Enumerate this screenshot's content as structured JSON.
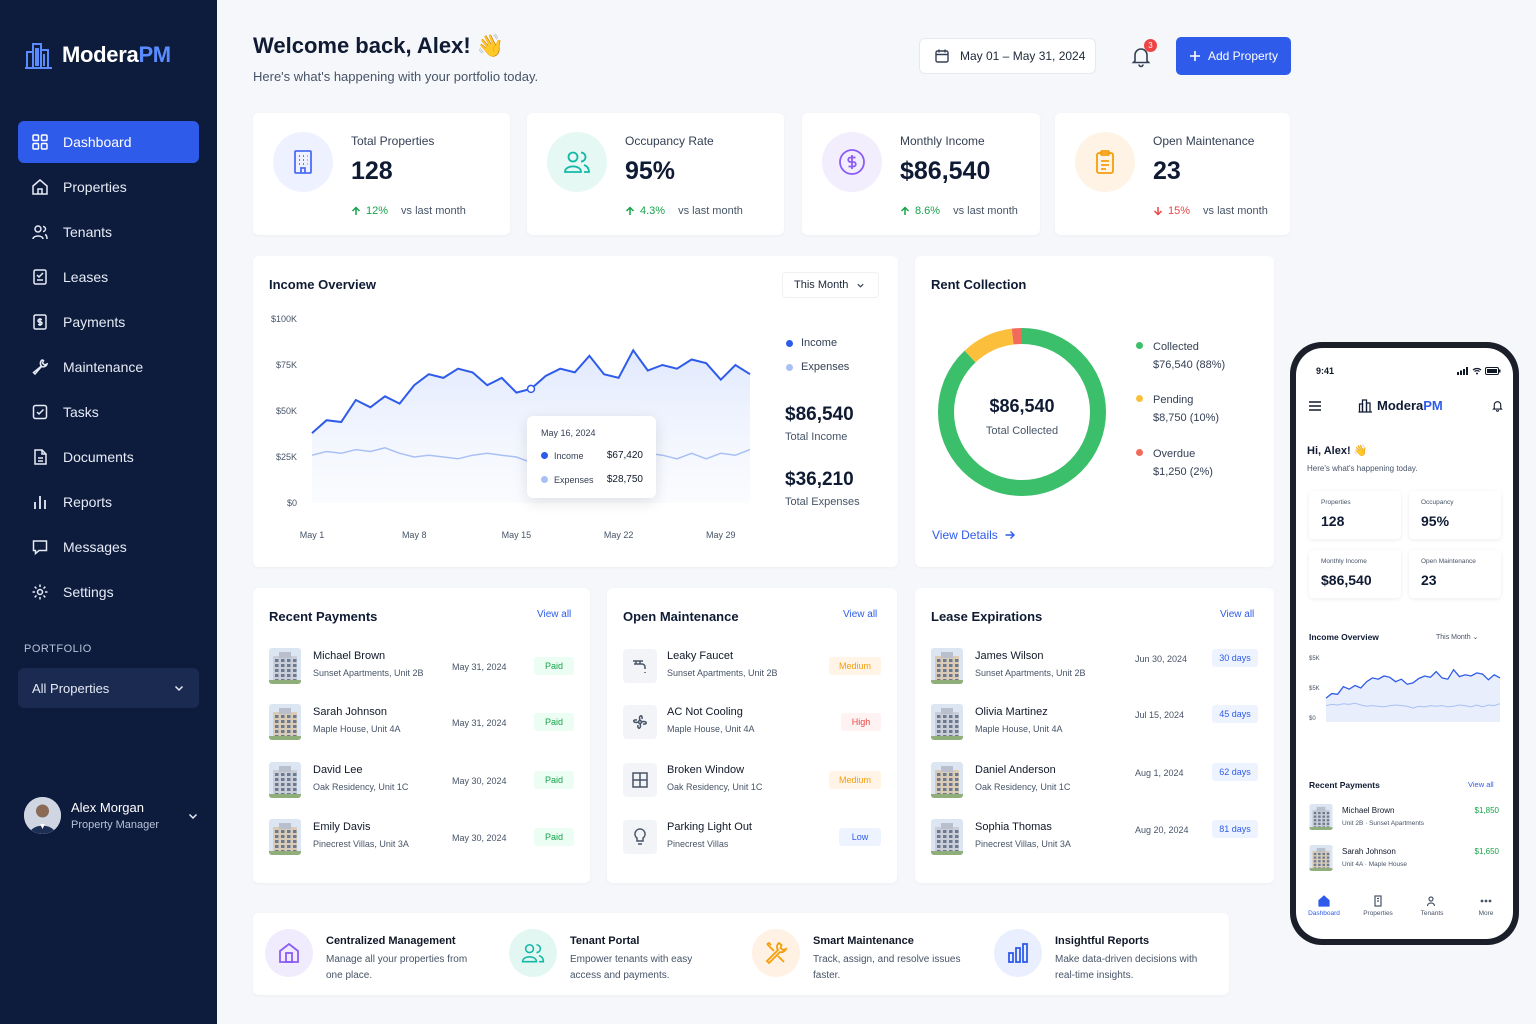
{
  "app": {
    "brand_main": "Modera",
    "brand_accent": "PM"
  },
  "sidebar": {
    "items": [
      {
        "label": "Dashboard",
        "icon": "dashboard-icon",
        "active": true
      },
      {
        "label": "Properties",
        "icon": "home-icon"
      },
      {
        "label": "Tenants",
        "icon": "users-icon"
      },
      {
        "label": "Leases",
        "icon": "lease-icon"
      },
      {
        "label": "Payments",
        "icon": "payment-icon"
      },
      {
        "label": "Maintenance",
        "icon": "wrench-icon"
      },
      {
        "label": "Tasks",
        "icon": "checkbox-icon"
      },
      {
        "label": "Documents",
        "icon": "document-icon"
      },
      {
        "label": "Reports",
        "icon": "bar-chart-icon"
      },
      {
        "label": "Messages",
        "icon": "message-icon"
      },
      {
        "label": "Settings",
        "icon": "gear-icon"
      }
    ],
    "portfolio_label": "PORTFOLIO",
    "portfolio_value": "All Properties",
    "user": {
      "name": "Alex Morgan",
      "role": "Property Manager"
    }
  },
  "header": {
    "welcome": "Welcome back, Alex! 👋",
    "subtitle": "Here's what's happening with your portfolio today.",
    "date_range": "May 01 – May 31, 2024",
    "notifications": "3",
    "add_button": "Add Property"
  },
  "stats": [
    {
      "label": "Total Properties",
      "value": "128",
      "change": "12%",
      "direction": "up",
      "vs": "vs last month",
      "color": "#4f6df5"
    },
    {
      "label": "Occupancy Rate",
      "value": "95%",
      "change": "4.3%",
      "direction": "up",
      "vs": "vs last month",
      "color": "#14b8a6"
    },
    {
      "label": "Monthly Income",
      "value": "$86,540",
      "change": "8.6%",
      "direction": "up",
      "vs": "vs last month",
      "color": "#8b5cf6"
    },
    {
      "label": "Open Maintenance",
      "value": "23",
      "change": "15%",
      "direction": "down",
      "vs": "vs last month",
      "color": "#f59e0b"
    }
  ],
  "income_overview": {
    "title": "Income Overview",
    "period": "This Month",
    "legend_income": "Income",
    "legend_expenses": "Expenses",
    "total_income": "$86,540",
    "total_income_label": "Total Income",
    "total_expenses": "$36,210",
    "total_expenses_label": "Total Expenses",
    "tooltip": {
      "date": "May 16, 2024",
      "income_label": "Income",
      "income_value": "$67,420",
      "expenses_label": "Expenses",
      "expenses_value": "$28,750"
    }
  },
  "chart_data": {
    "type": "area",
    "y_ticks": [
      "$100K",
      "$75K",
      "$50K",
      "$25K",
      "$0"
    ],
    "x_ticks": [
      "May 1",
      "May 8",
      "May 15",
      "May 22",
      "May 29"
    ],
    "ylim": [
      0,
      100000
    ],
    "x": [
      1,
      2,
      3,
      4,
      5,
      6,
      7,
      8,
      9,
      10,
      11,
      12,
      13,
      14,
      15,
      16,
      17,
      18,
      19,
      20,
      21,
      22,
      23,
      24,
      25,
      26,
      27,
      28,
      29,
      30,
      31
    ],
    "series": [
      {
        "name": "Income",
        "color": "#2f5bea",
        "values": [
          38000,
          45000,
          44000,
          56000,
          52000,
          58000,
          54000,
          64000,
          70000,
          68000,
          73000,
          71000,
          64000,
          68000,
          60000,
          62000,
          69000,
          73000,
          71000,
          80000,
          70000,
          68000,
          83000,
          72000,
          75000,
          73000,
          78000,
          76000,
          67000,
          75000,
          70000
        ]
      },
      {
        "name": "Expenses",
        "color": "#a9c0f5",
        "values": [
          26000,
          28000,
          27000,
          29000,
          28000,
          30000,
          27000,
          25000,
          26000,
          25000,
          24000,
          26000,
          27000,
          26000,
          25000,
          22000,
          25000,
          24000,
          26000,
          25000,
          26000,
          24000,
          25000,
          27000,
          26000,
          24000,
          27000,
          24000,
          27000,
          26000,
          29000
        ]
      }
    ]
  },
  "rent_collection": {
    "title": "Rent Collection",
    "total": "$86,540",
    "total_label": "Total Collected",
    "segments": [
      {
        "label": "Collected",
        "value": "$76,540 (88%)",
        "share": 88,
        "color": "#3cbf6b"
      },
      {
        "label": "Pending",
        "value": "$8,750 (10%)",
        "share": 10,
        "color": "#fbbf3c"
      },
      {
        "label": "Overdue",
        "value": "$1,250 (2%)",
        "share": 2,
        "color": "#f26a5b"
      }
    ],
    "view_details": "View Details"
  },
  "recent_payments": {
    "title": "Recent Payments",
    "view_all": "View all",
    "rows": [
      {
        "name": "Michael Brown",
        "sub": "Sunset Apartments, Unit 2B",
        "date": "May 31, 2024",
        "status": "Paid"
      },
      {
        "name": "Sarah Johnson",
        "sub": "Maple House, Unit 4A",
        "date": "May 31, 2024",
        "status": "Paid"
      },
      {
        "name": "David Lee",
        "sub": "Oak Residency, Unit 1C",
        "date": "May 30, 2024",
        "status": "Paid"
      },
      {
        "name": "Emily Davis",
        "sub": "Pinecrest Villas, Unit 3A",
        "date": "May 30, 2024",
        "status": "Paid"
      }
    ]
  },
  "open_maintenance": {
    "title": "Open Maintenance",
    "view_all": "View all",
    "rows": [
      {
        "name": "Leaky Faucet",
        "sub": "Sunset Apartments, Unit 2B",
        "priority": "Medium",
        "icon": "faucet-icon"
      },
      {
        "name": "AC Not Cooling",
        "sub": "Maple House, Unit 4A",
        "priority": "High",
        "icon": "fan-icon"
      },
      {
        "name": "Broken Window",
        "sub": "Oak Residency, Unit 1C",
        "priority": "Medium",
        "icon": "window-icon"
      },
      {
        "name": "Parking Light Out",
        "sub": "Pinecrest Villas",
        "priority": "Low",
        "icon": "lightbulb-icon"
      }
    ]
  },
  "lease_expirations": {
    "title": "Lease Expirations",
    "view_all": "View all",
    "rows": [
      {
        "name": "James Wilson",
        "sub": "Sunset Apartments, Unit 2B",
        "date": "Jun 30, 2024",
        "days": "30 days"
      },
      {
        "name": "Olivia Martinez",
        "sub": "Maple House, Unit 4A",
        "date": "Jul 15, 2024",
        "days": "45 days"
      },
      {
        "name": "Daniel Anderson",
        "sub": "Oak Residency, Unit 1C",
        "date": "Aug 1, 2024",
        "days": "62 days"
      },
      {
        "name": "Sophia Thomas",
        "sub": "Pinecrest Villas, Unit 3A",
        "date": "Aug 20, 2024",
        "days": "81 days"
      }
    ]
  },
  "features": [
    {
      "title": "Centralized Management",
      "desc": "Manage all your properties from one place.",
      "color": "#8b5cf6"
    },
    {
      "title": "Tenant Portal",
      "desc": "Empower tenants with easy access and payments.",
      "color": "#14b8a6"
    },
    {
      "title": "Smart Maintenance",
      "desc": "Track, assign, and resolve issues faster.",
      "color": "#f59e0b"
    },
    {
      "title": "Insightful Reports",
      "desc": "Make data-driven decisions with real-time insights.",
      "color": "#2f5bea"
    }
  ],
  "phone": {
    "time": "9:41",
    "greeting": "Hi, Alex! 👋",
    "sub": "Here's what's happening today.",
    "cards": [
      {
        "label": "Properties",
        "value": "128"
      },
      {
        "label": "Occupancy",
        "value": "95%"
      },
      {
        "label": "Monthly Income",
        "value": "$86,540"
      },
      {
        "label": "Open Maintenance",
        "value": "23"
      }
    ],
    "income_title": "Income Overview",
    "period": "This Month",
    "y_ticks": [
      "$5K",
      "$5K",
      "$0"
    ],
    "payments_title": "Recent Payments",
    "view_all": "View all",
    "payments": [
      {
        "name": "Michael Brown",
        "sub": "Unit 2B · Sunset Apartments",
        "amount": "$1,850"
      },
      {
        "name": "Sarah Johnson",
        "sub": "Unit 4A · Maple House",
        "amount": "$1,650"
      }
    ],
    "tabs": [
      "Dashboard",
      "Properties",
      "Tenants",
      "More"
    ]
  }
}
